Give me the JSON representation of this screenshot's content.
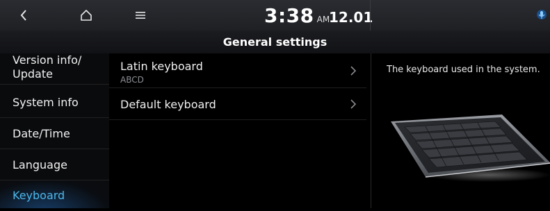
{
  "status_bar": {
    "time": "3:38",
    "ampm": "AM",
    "date": "12.01",
    "icons": [
      "back-arrow-icon",
      "home-icon",
      "menu-icon",
      "voice-mic-icon"
    ]
  },
  "page_title": "General settings",
  "sidebar": {
    "items": [
      {
        "label_line1": "Version info/",
        "label_line2": "Update"
      },
      {
        "label": "System info"
      },
      {
        "label": "Date/Time"
      },
      {
        "label": "Language"
      },
      {
        "label": "Keyboard",
        "active": true
      }
    ]
  },
  "list": {
    "items": [
      {
        "label": "Latin keyboard",
        "value": "ABCD"
      },
      {
        "label": "Default keyboard"
      }
    ]
  },
  "info_panel": {
    "description": "The keyboard used in the system."
  },
  "colors": {
    "accent": "#4db7e9",
    "background": "#000000",
    "topbar": "#25272c"
  }
}
